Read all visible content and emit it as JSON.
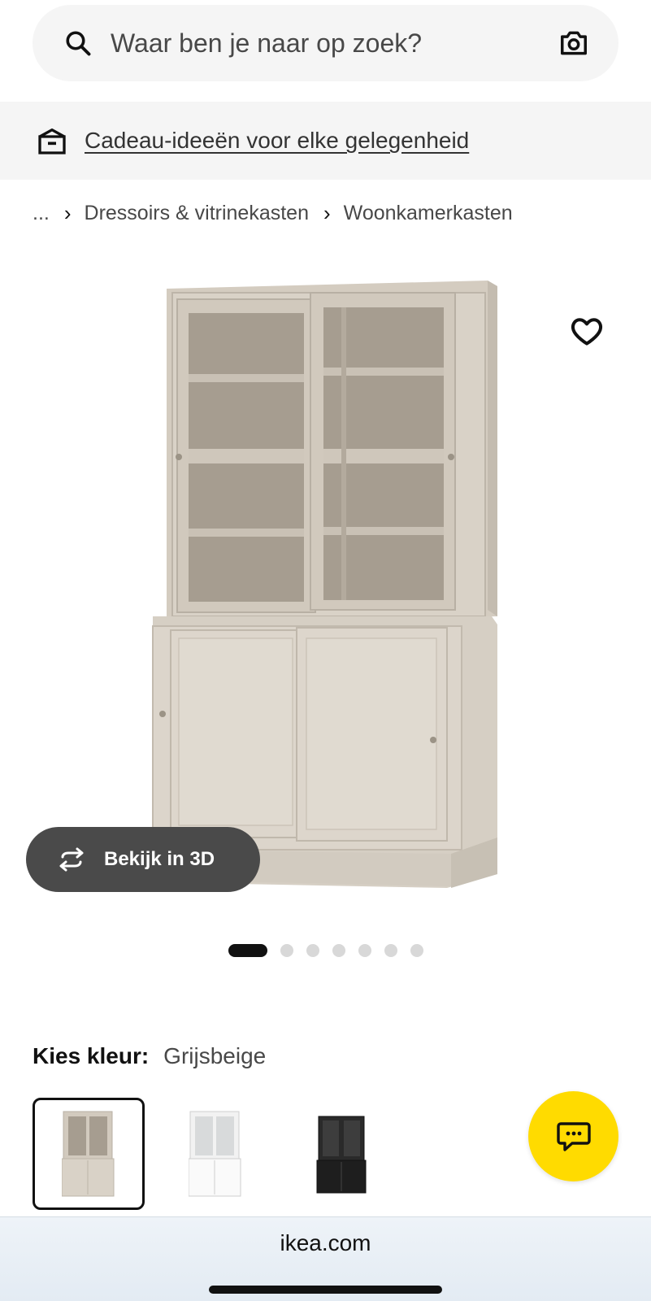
{
  "search": {
    "placeholder": "Waar ben je naar op zoek?",
    "icon": "search-icon",
    "camera_icon": "camera-icon"
  },
  "promo": {
    "text": "Cadeau-ideeën voor elke gelegenheid",
    "icon": "gift-box-icon"
  },
  "breadcrumb": {
    "ellipsis": "...",
    "separator": "›",
    "items": [
      "Dressoirs & vitrinekasten",
      "Woonkamerkasten"
    ]
  },
  "product": {
    "image_icon": "cabinet-image",
    "favorite_icon": "heart-icon",
    "view_3d_label": "Bekijk in 3D",
    "view_3d_icon": "rotate-icon",
    "carousel": {
      "total": 7,
      "active_index": 0
    }
  },
  "color_picker": {
    "label": "Kies kleur:",
    "selected_value": "Grijsbeige",
    "options": [
      "grijsbeige",
      "wit",
      "zwart"
    ]
  },
  "chat": {
    "icon": "chat-icon",
    "color": "#ffdb00"
  },
  "browser": {
    "url": "ikea.com"
  },
  "colors": {
    "chat_yellow": "#ffdb00",
    "cabinet_beige": "#d6cfc4",
    "button_dark": "#4a4a4a"
  }
}
